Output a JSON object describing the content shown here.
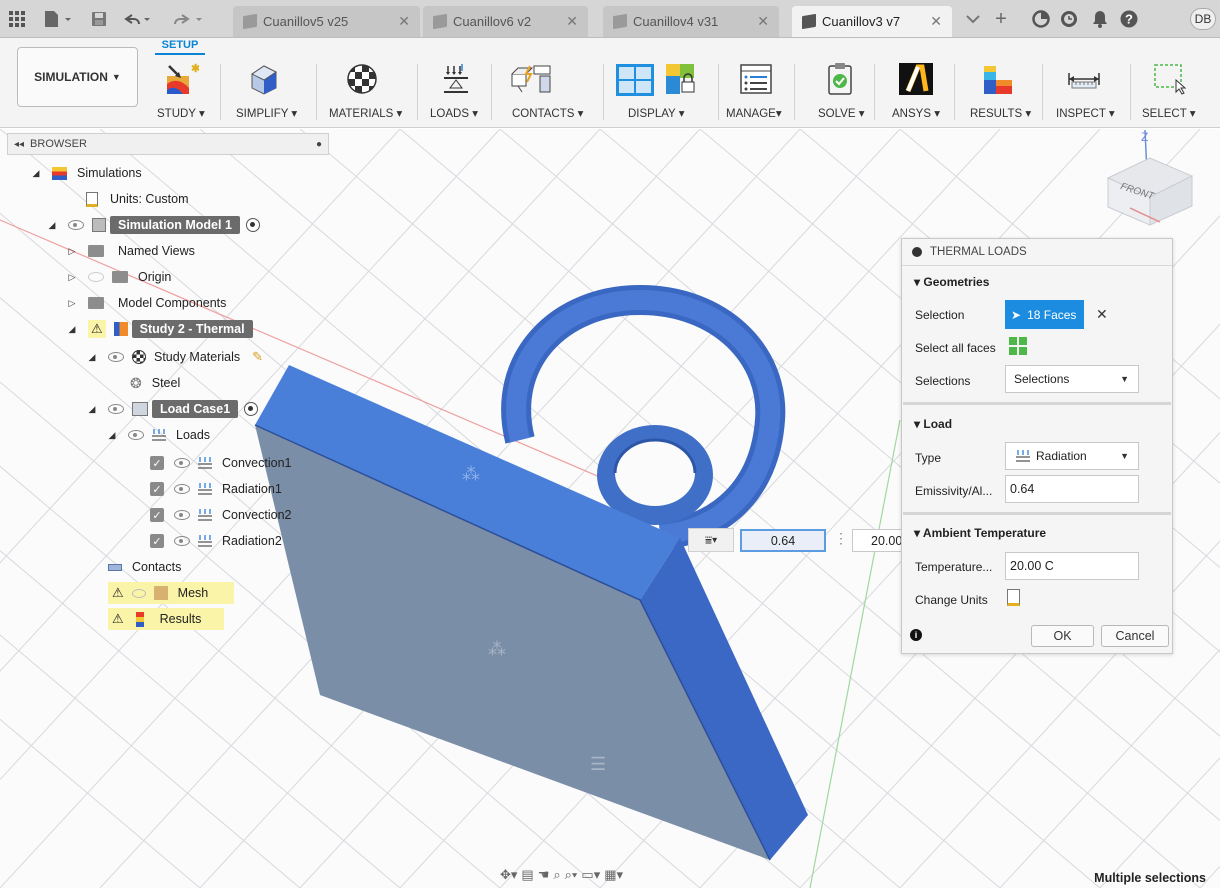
{
  "tabs": [
    {
      "label": "Cuanillov5 v25",
      "active": false
    },
    {
      "label": "Cuanillov6 v2",
      "active": false
    },
    {
      "label": "Cuanillov4 v31",
      "active": false
    },
    {
      "label": "Cuanillov3 v7",
      "active": true
    }
  ],
  "user_initials": "DB",
  "workspace": "SIMULATION",
  "setup_tab": "SETUP",
  "toolbar": {
    "study": "STUDY",
    "simplify": "SIMPLIFY",
    "materials": "MATERIALS",
    "loads": "LOADS",
    "contacts": "CONTACTS",
    "display": "DISPLAY",
    "manage": "MANAGE",
    "solve": "SOLVE",
    "ansys": "ANSYS",
    "results": "RESULTS",
    "inspect": "INSPECT",
    "select": "SELECT"
  },
  "browser": {
    "title": "BROWSER",
    "simulations": "Simulations",
    "units": "Units: Custom",
    "model": "Simulation Model 1",
    "named_views": "Named Views",
    "origin": "Origin",
    "model_components": "Model Components",
    "study": "Study 2 - Thermal",
    "study_materials": "Study Materials",
    "steel": "Steel",
    "load_case": "Load Case1",
    "loads": "Loads",
    "load_items": [
      "Convection1",
      "Radiation1",
      "Convection2",
      "Radiation2"
    ],
    "contacts": "Contacts",
    "mesh": "Mesh",
    "results": "Results"
  },
  "panel": {
    "title": "THERMAL LOADS",
    "geometries": "Geometries",
    "selection_label": "Selection",
    "selection_value": "18 Faces",
    "select_all_label": "Select all faces",
    "selections_label": "Selections",
    "selections_value": "Selections",
    "load_section": "Load",
    "type_label": "Type",
    "type_value": "Radiation",
    "emissivity_label": "Emissivity/Al...",
    "emissivity_value": "0.64",
    "ambient_section": "Ambient Temperature",
    "temperature_label": "Temperature...",
    "temperature_value": "20.00 C",
    "change_units_label": "Change Units",
    "ok": "OK",
    "cancel": "Cancel"
  },
  "inline_input": {
    "emissivity": "0.64",
    "temperature": "20.00"
  },
  "viewcube_face": "FRONT",
  "status": "Multiple selections",
  "colors": {
    "accent": "#0a84d6",
    "model": "#3f6fc7",
    "plate_face": "#7d8fa6",
    "warning": "#faf4a8"
  }
}
